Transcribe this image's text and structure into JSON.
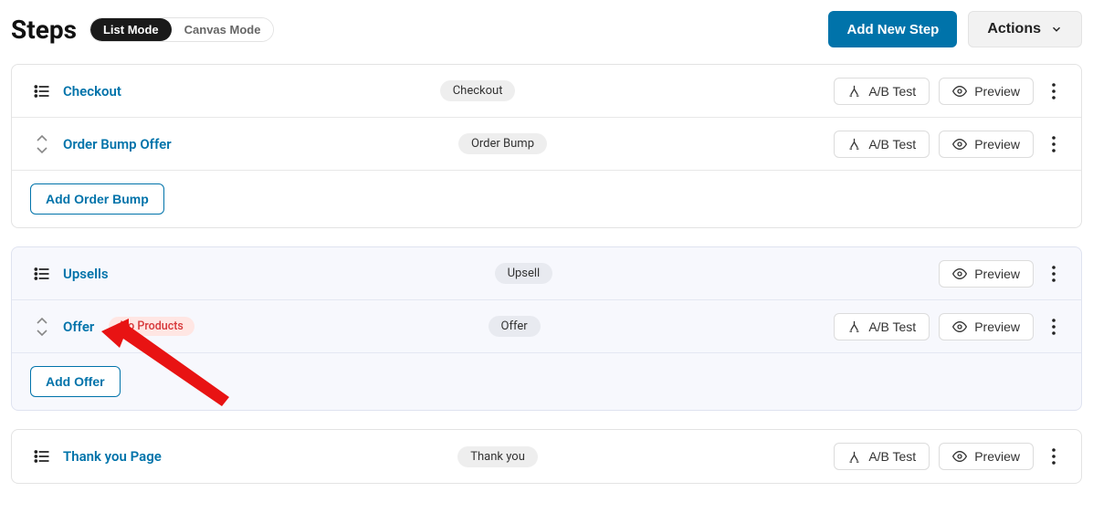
{
  "header": {
    "title": "Steps",
    "mode_list": "List Mode",
    "mode_canvas": "Canvas Mode",
    "add_new": "Add New Step",
    "actions": "Actions"
  },
  "buttons": {
    "ab_test": "A/B Test",
    "preview": "Preview",
    "add_order_bump": "Add Order Bump",
    "add_offer": "Add Offer"
  },
  "labels": {
    "no_products": "No Products"
  },
  "groups": [
    {
      "rows": [
        {
          "title": "Checkout",
          "tag": "Checkout",
          "has_ab": true
        },
        {
          "title": "Order Bump Offer",
          "tag": "Order Bump",
          "has_ab": true,
          "sortable": true
        }
      ],
      "add_label": "Add Order Bump"
    },
    {
      "highlight": true,
      "rows": [
        {
          "title": "Upsells",
          "tag": "Upsell",
          "has_ab": false
        },
        {
          "title": "Offer",
          "tag": "Offer",
          "has_ab": true,
          "sortable": true,
          "warn": "No Products"
        }
      ],
      "add_label": "Add Offer"
    },
    {
      "rows": [
        {
          "title": "Thank you Page",
          "tag": "Thank you",
          "has_ab": true
        }
      ]
    }
  ]
}
